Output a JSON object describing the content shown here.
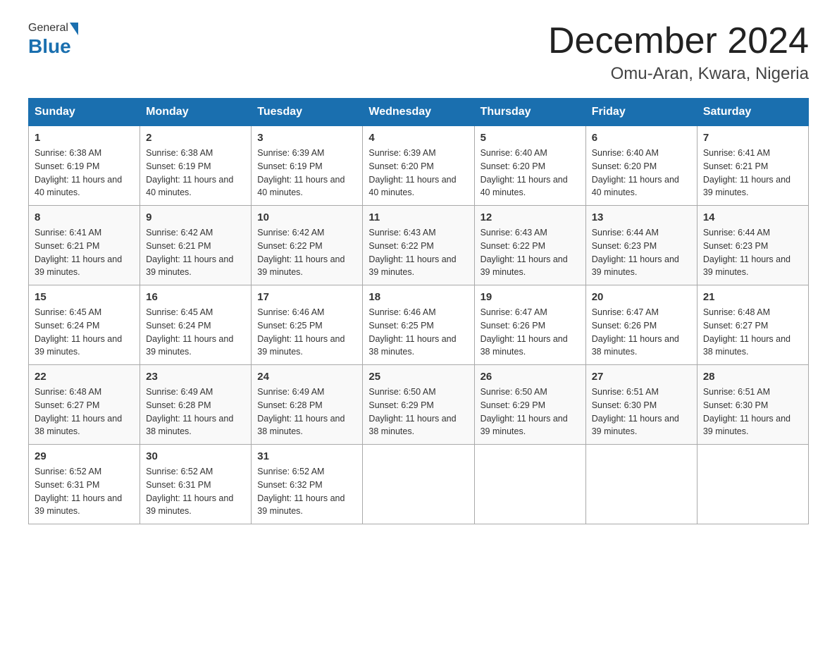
{
  "header": {
    "logo_general": "General",
    "logo_blue": "Blue",
    "title": "December 2024",
    "subtitle": "Omu-Aran, Kwara, Nigeria"
  },
  "days_of_week": [
    "Sunday",
    "Monday",
    "Tuesday",
    "Wednesday",
    "Thursday",
    "Friday",
    "Saturday"
  ],
  "weeks": [
    [
      {
        "day": "1",
        "sunrise": "6:38 AM",
        "sunset": "6:19 PM",
        "daylight": "11 hours and 40 minutes."
      },
      {
        "day": "2",
        "sunrise": "6:38 AM",
        "sunset": "6:19 PM",
        "daylight": "11 hours and 40 minutes."
      },
      {
        "day": "3",
        "sunrise": "6:39 AM",
        "sunset": "6:19 PM",
        "daylight": "11 hours and 40 minutes."
      },
      {
        "day": "4",
        "sunrise": "6:39 AM",
        "sunset": "6:20 PM",
        "daylight": "11 hours and 40 minutes."
      },
      {
        "day": "5",
        "sunrise": "6:40 AM",
        "sunset": "6:20 PM",
        "daylight": "11 hours and 40 minutes."
      },
      {
        "day": "6",
        "sunrise": "6:40 AM",
        "sunset": "6:20 PM",
        "daylight": "11 hours and 40 minutes."
      },
      {
        "day": "7",
        "sunrise": "6:41 AM",
        "sunset": "6:21 PM",
        "daylight": "11 hours and 39 minutes."
      }
    ],
    [
      {
        "day": "8",
        "sunrise": "6:41 AM",
        "sunset": "6:21 PM",
        "daylight": "11 hours and 39 minutes."
      },
      {
        "day": "9",
        "sunrise": "6:42 AM",
        "sunset": "6:21 PM",
        "daylight": "11 hours and 39 minutes."
      },
      {
        "day": "10",
        "sunrise": "6:42 AM",
        "sunset": "6:22 PM",
        "daylight": "11 hours and 39 minutes."
      },
      {
        "day": "11",
        "sunrise": "6:43 AM",
        "sunset": "6:22 PM",
        "daylight": "11 hours and 39 minutes."
      },
      {
        "day": "12",
        "sunrise": "6:43 AM",
        "sunset": "6:22 PM",
        "daylight": "11 hours and 39 minutes."
      },
      {
        "day": "13",
        "sunrise": "6:44 AM",
        "sunset": "6:23 PM",
        "daylight": "11 hours and 39 minutes."
      },
      {
        "day": "14",
        "sunrise": "6:44 AM",
        "sunset": "6:23 PM",
        "daylight": "11 hours and 39 minutes."
      }
    ],
    [
      {
        "day": "15",
        "sunrise": "6:45 AM",
        "sunset": "6:24 PM",
        "daylight": "11 hours and 39 minutes."
      },
      {
        "day": "16",
        "sunrise": "6:45 AM",
        "sunset": "6:24 PM",
        "daylight": "11 hours and 39 minutes."
      },
      {
        "day": "17",
        "sunrise": "6:46 AM",
        "sunset": "6:25 PM",
        "daylight": "11 hours and 39 minutes."
      },
      {
        "day": "18",
        "sunrise": "6:46 AM",
        "sunset": "6:25 PM",
        "daylight": "11 hours and 38 minutes."
      },
      {
        "day": "19",
        "sunrise": "6:47 AM",
        "sunset": "6:26 PM",
        "daylight": "11 hours and 38 minutes."
      },
      {
        "day": "20",
        "sunrise": "6:47 AM",
        "sunset": "6:26 PM",
        "daylight": "11 hours and 38 minutes."
      },
      {
        "day": "21",
        "sunrise": "6:48 AM",
        "sunset": "6:27 PM",
        "daylight": "11 hours and 38 minutes."
      }
    ],
    [
      {
        "day": "22",
        "sunrise": "6:48 AM",
        "sunset": "6:27 PM",
        "daylight": "11 hours and 38 minutes."
      },
      {
        "day": "23",
        "sunrise": "6:49 AM",
        "sunset": "6:28 PM",
        "daylight": "11 hours and 38 minutes."
      },
      {
        "day": "24",
        "sunrise": "6:49 AM",
        "sunset": "6:28 PM",
        "daylight": "11 hours and 38 minutes."
      },
      {
        "day": "25",
        "sunrise": "6:50 AM",
        "sunset": "6:29 PM",
        "daylight": "11 hours and 38 minutes."
      },
      {
        "day": "26",
        "sunrise": "6:50 AM",
        "sunset": "6:29 PM",
        "daylight": "11 hours and 39 minutes."
      },
      {
        "day": "27",
        "sunrise": "6:51 AM",
        "sunset": "6:30 PM",
        "daylight": "11 hours and 39 minutes."
      },
      {
        "day": "28",
        "sunrise": "6:51 AM",
        "sunset": "6:30 PM",
        "daylight": "11 hours and 39 minutes."
      }
    ],
    [
      {
        "day": "29",
        "sunrise": "6:52 AM",
        "sunset": "6:31 PM",
        "daylight": "11 hours and 39 minutes."
      },
      {
        "day": "30",
        "sunrise": "6:52 AM",
        "sunset": "6:31 PM",
        "daylight": "11 hours and 39 minutes."
      },
      {
        "day": "31",
        "sunrise": "6:52 AM",
        "sunset": "6:32 PM",
        "daylight": "11 hours and 39 minutes."
      },
      null,
      null,
      null,
      null
    ]
  ],
  "labels": {
    "sunrise": "Sunrise:",
    "sunset": "Sunset:",
    "daylight": "Daylight:"
  }
}
